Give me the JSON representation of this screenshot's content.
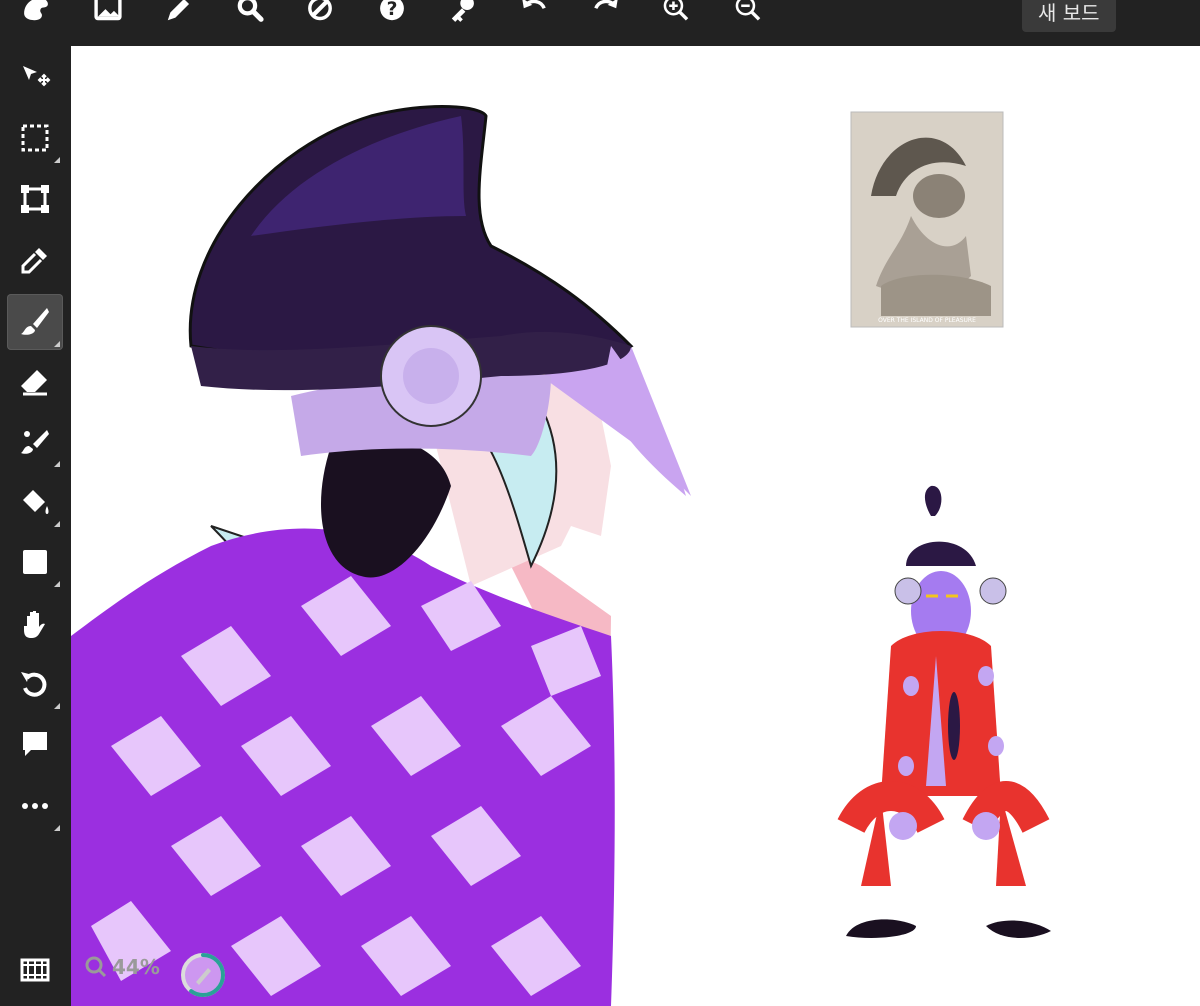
{
  "toolbar": {
    "new_board_label": "새 보드",
    "icons": [
      "app-logo-icon",
      "image-icon",
      "pencil-icon",
      "search-icon",
      "eraser-icon",
      "help-icon",
      "key-icon",
      "undo-icon",
      "redo-icon",
      "zoom-in-icon",
      "zoom-out-icon"
    ]
  },
  "sidebar": {
    "tools": [
      "move-tool",
      "select-tool",
      "transform-tool",
      "eyedropper-tool",
      "brush-tool",
      "eraser-tool",
      "smudge-tool",
      "fill-tool",
      "shape-tool",
      "hand-tool",
      "rotate-tool",
      "comment-tool",
      "more-tool"
    ],
    "active_tool": "brush-tool",
    "bottom_icon": "film-strip-icon"
  },
  "status": {
    "zoom_label": "44%",
    "progress_fraction": 0.6
  },
  "reference_photo": {
    "caption": "OVER THE ISLAND OF PLEASURE"
  },
  "colors": {
    "chrome": "#222222",
    "canvas": "#ffffff",
    "accent": "#2aa198",
    "purple": "#9b2fe0",
    "lavender": "#e7c6fb",
    "red": "#e8332e"
  }
}
